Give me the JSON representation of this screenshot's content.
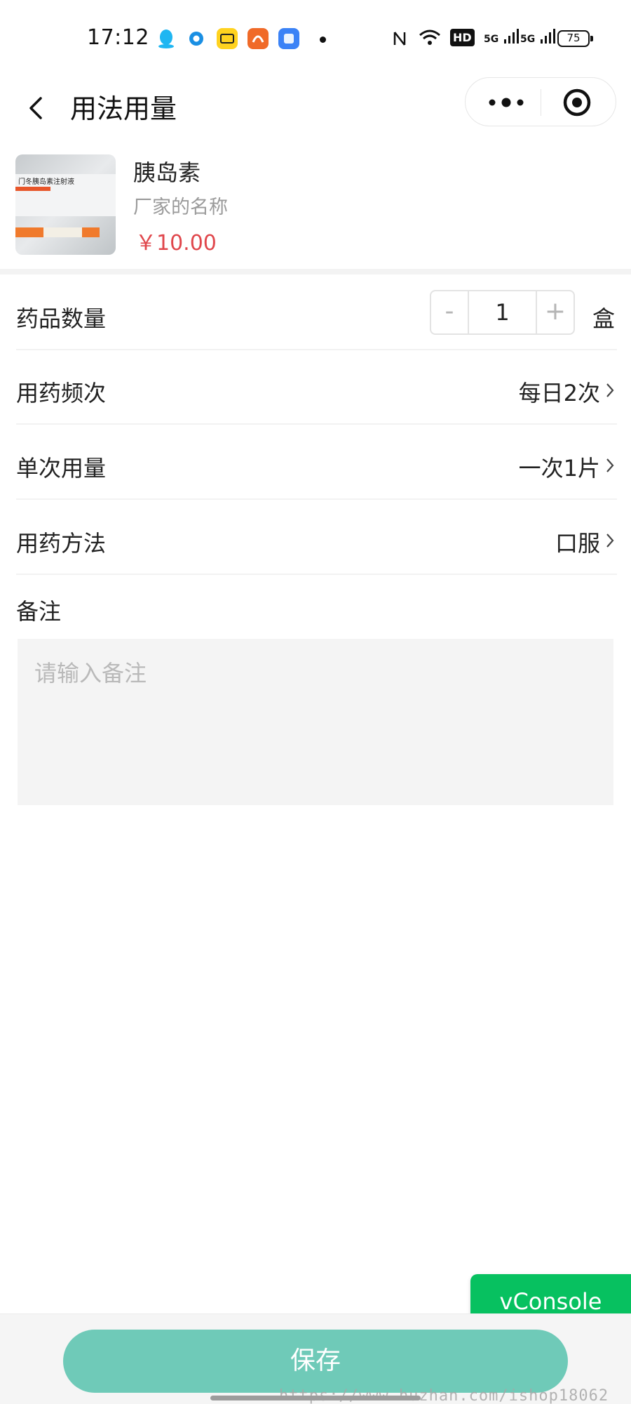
{
  "status_bar": {
    "time": "17:12",
    "signal_label_1": "5G",
    "signal_label_2": "5G",
    "hd_label": "HD",
    "battery": "75",
    "icons": [
      "qq-icon",
      "browser-icon",
      "meituan-icon",
      "uc-browser-icon",
      "multitask-icon",
      "nfc-icon",
      "wifi-icon"
    ],
    "colors": {
      "qq": "#1fb6f2",
      "uc": "#f06a28",
      "meituan": "#ffd21f",
      "multitask": "#3b82f6"
    }
  },
  "nav": {
    "title": "用法用量"
  },
  "product": {
    "name": "胰岛素",
    "manufacturer": "厂家的名称",
    "price": "￥10.00",
    "thumb_text": "门冬胰岛素注射液"
  },
  "form": {
    "quantity": {
      "label": "药品数量",
      "value": "1",
      "minus": "-",
      "plus": "+",
      "unit": "盒"
    },
    "frequency": {
      "label": "用药频次",
      "value": "每日2次"
    },
    "dose": {
      "label": "单次用量",
      "value": "一次1片"
    },
    "method": {
      "label": "用药方法",
      "value": "口服"
    },
    "notes": {
      "label": "备注",
      "placeholder": "请输入备注",
      "value": ""
    }
  },
  "vconsole": {
    "label": "vConsole",
    "color": "#07c160"
  },
  "footer": {
    "save_label": "保存",
    "save_color": "#6fcab8",
    "watermark": "https://www.huzhan.com/ishop18062"
  }
}
